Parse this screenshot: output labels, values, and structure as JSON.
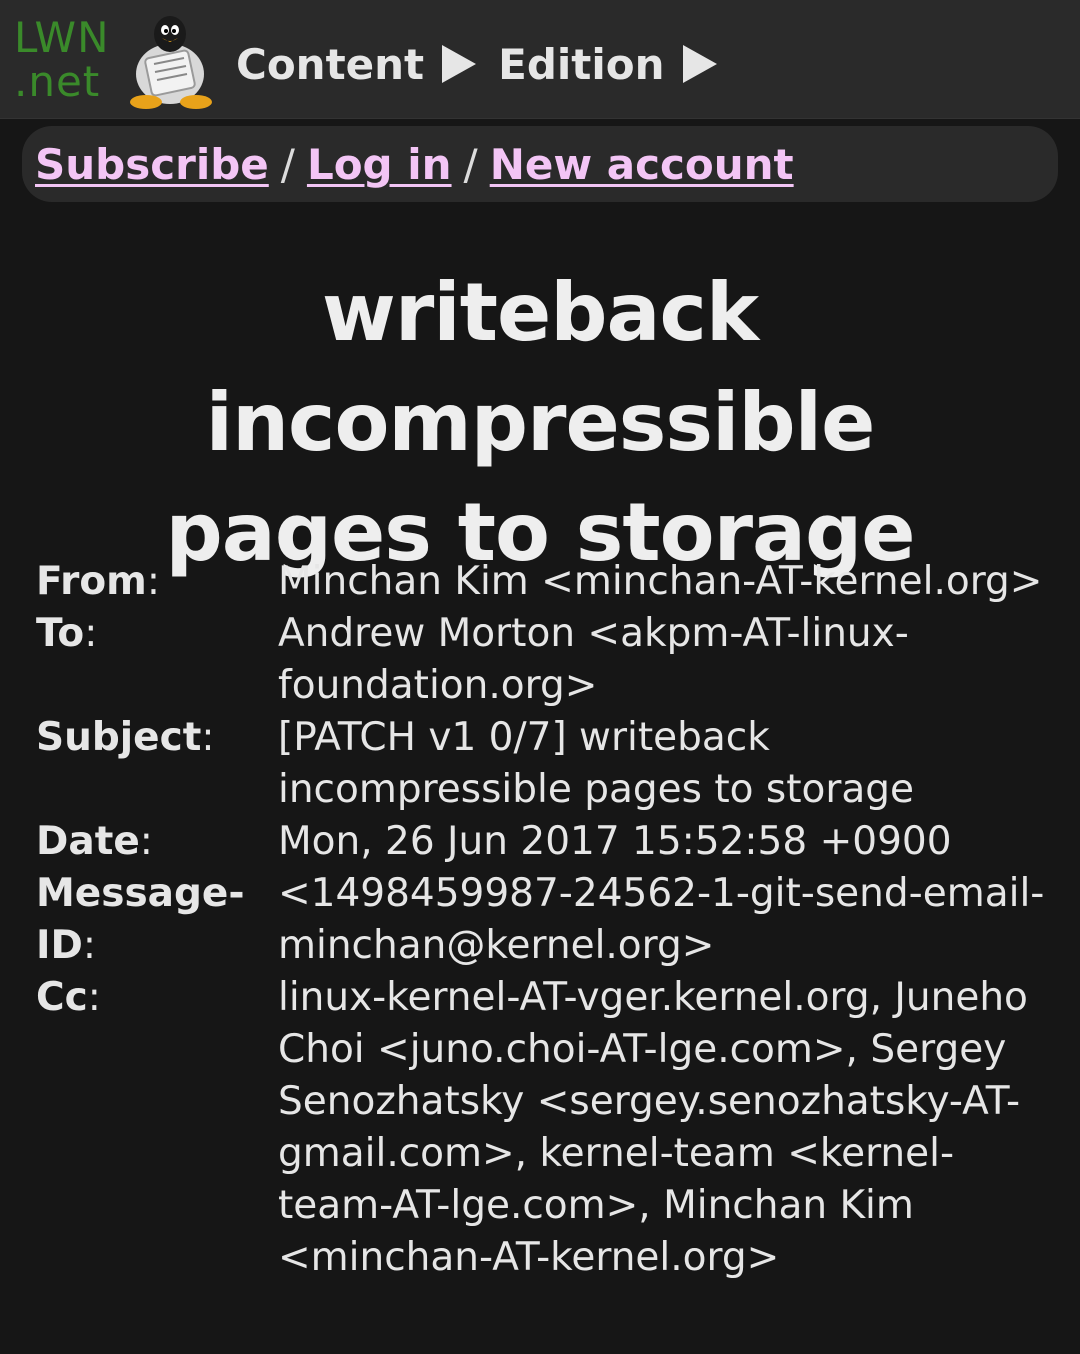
{
  "logo": {
    "line1": "LWN",
    "line2": ".net"
  },
  "nav": {
    "items": [
      {
        "label": "Content"
      },
      {
        "label": "Edition"
      }
    ]
  },
  "auth": {
    "subscribe": "Subscribe",
    "login": "Log in",
    "new_account": "New account",
    "separator": "/"
  },
  "article": {
    "title_line1": "writeback incompressible",
    "title_line2": "pages to storage"
  },
  "headers": [
    {
      "key": "From",
      "value": "Minchan Kim <minchan-AT-kernel.org>"
    },
    {
      "key": "To",
      "value": "Andrew Morton <akpm-AT-linux-foundation.org>"
    },
    {
      "key": "Subject",
      "value": "[PATCH v1 0/7] writeback incompressible pages to storage"
    },
    {
      "key": "Date",
      "value": "Mon, 26 Jun 2017 15:52:58 +0900"
    },
    {
      "key": "Message-ID",
      "value": "<1498459987-24562-1-git-send-email-minchan@kernel.org>"
    },
    {
      "key": "Cc",
      "value": "linux-kernel-AT-vger.kernel.org, Juneho Choi <juno.choi-AT-lge.com>, Sergey Senozhatsky <sergey.senozhatsky-AT-gmail.com>, kernel-team <kernel-team-AT-lge.com>, Minchan Kim <minchan-AT-kernel.org>"
    }
  ],
  "colors": {
    "background": "#161616",
    "topbar": "#2a2a2a",
    "link": "#f3c5f5",
    "logo_green": "#3a8a2a"
  }
}
